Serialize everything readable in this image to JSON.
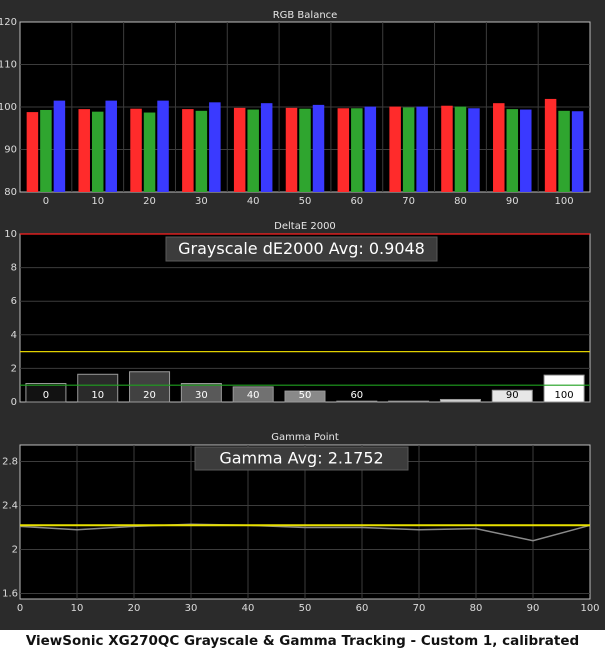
{
  "caption": "ViewSonic XG270QC Grayscale & Gamma Tracking - Custom 1, calibrated",
  "colors": {
    "background": "#2b2b2b",
    "plot_area": "#000000",
    "grid": "#3c3c3c",
    "red": "#ff2b2b",
    "green": "#2fa52f",
    "blue": "#3a3aff",
    "reference_red": "#ff2020",
    "threshold_yellow": "#e0d000",
    "threshold_green": "#1f9f1f",
    "gamma_target": "#e8e000",
    "gamma_measured": "#8a8a8a"
  },
  "chart_data": [
    {
      "type": "bar",
      "title": "RGB Balance",
      "categories": [
        "0",
        "10",
        "20",
        "30",
        "40",
        "50",
        "60",
        "70",
        "80",
        "90",
        "100"
      ],
      "ylim": [
        80,
        120
      ],
      "yticks": [
        "80",
        "90",
        "100",
        "110",
        "120"
      ],
      "grid": true,
      "series": [
        {
          "color": "red",
          "values": [
            98.8,
            99.5,
            99.6,
            99.5,
            99.8,
            99.8,
            99.7,
            100.1,
            100.3,
            100.9,
            101.9
          ]
        },
        {
          "color": "green",
          "values": [
            99.3,
            98.9,
            98.7,
            99.1,
            99.4,
            99.6,
            99.7,
            99.9,
            100.1,
            99.5,
            99.1
          ]
        },
        {
          "color": "blue",
          "values": [
            101.5,
            101.5,
            101.5,
            101.1,
            100.9,
            100.5,
            100.1,
            100.1,
            99.7,
            99.4,
            99.0
          ]
        }
      ]
    },
    {
      "type": "bar",
      "title": "DeltaE 2000",
      "annotation": "Grayscale dE2000 Avg: 0.9048",
      "categories": [
        "0",
        "10",
        "20",
        "30",
        "40",
        "50",
        "60",
        "70",
        "80",
        "90",
        "100"
      ],
      "ylim": [
        0,
        10
      ],
      "yticks": [
        "0",
        "2",
        "4",
        "6",
        "8",
        "10"
      ],
      "values": [
        1.1,
        1.65,
        1.8,
        1.1,
        0.9,
        0.65,
        0.05,
        0.05,
        0.15,
        0.7,
        1.6
      ],
      "reference_lines": [
        {
          "value": 10,
          "color": "reference_red"
        },
        {
          "value": 3,
          "color": "threshold_yellow"
        },
        {
          "value": 1,
          "color": "threshold_green"
        }
      ]
    },
    {
      "type": "line",
      "title": "Gamma Point",
      "annotation": "Gamma Avg: 2.1752",
      "xlim": [
        0,
        100
      ],
      "ylim": [
        1.55,
        2.95
      ],
      "xticks": [
        "0",
        "10",
        "20",
        "30",
        "40",
        "50",
        "60",
        "70",
        "80",
        "90",
        "100"
      ],
      "yticks": [
        "1.6",
        "2",
        "2.4",
        "2.8"
      ],
      "series": [
        {
          "color": "gamma_measured",
          "x": [
            0,
            10,
            20,
            30,
            40,
            50,
            60,
            70,
            80,
            90,
            100
          ],
          "y": [
            2.21,
            2.18,
            2.21,
            2.23,
            2.22,
            2.2,
            2.2,
            2.18,
            2.19,
            2.08,
            2.22
          ]
        },
        {
          "color": "gamma_target",
          "x": [
            0,
            100
          ],
          "y": [
            2.22,
            2.22
          ]
        }
      ]
    }
  ]
}
